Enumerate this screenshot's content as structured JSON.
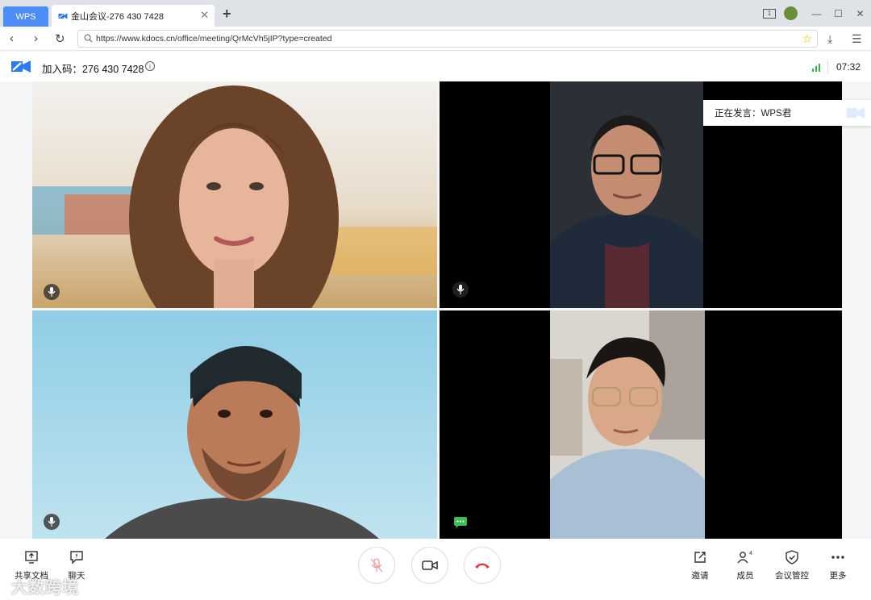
{
  "browser": {
    "tabs": [
      {
        "label": "WPS"
      },
      {
        "label": "金山会议-276 430 7428"
      }
    ],
    "url": "https://www.kdocs.cn/office/meeting/QrMcVh5jIP?type=created",
    "window_badge": "1"
  },
  "meeting": {
    "join_label": "加入码：276 430 7428",
    "time": "07:32",
    "speaking": "正在发言：WPS君"
  },
  "toolbar": {
    "left": [
      {
        "label": "共享文档",
        "icon": "share-screen-icon"
      },
      {
        "label": "聊天",
        "icon": "chat-icon"
      }
    ],
    "right": [
      {
        "label": "邀请",
        "icon": "invite-icon"
      },
      {
        "label": "成员",
        "icon": "members-icon",
        "count": "4"
      },
      {
        "label": "会议管控",
        "icon": "shield-icon"
      },
      {
        "label": "更多",
        "icon": "more-icon"
      }
    ]
  },
  "watermark": "大数跨境",
  "colors": {
    "accent": "#4b8cf5",
    "hangup": "#e23c39",
    "signal": "#35b24a",
    "chat_green": "#3dbd55"
  }
}
